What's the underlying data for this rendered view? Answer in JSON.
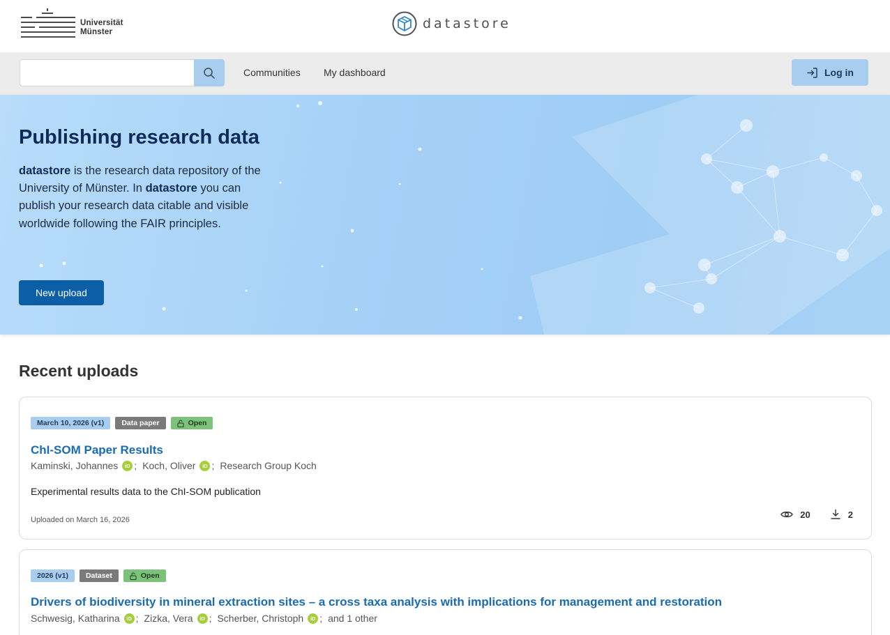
{
  "header": {
    "university_line1": "Universität",
    "university_line2": "Münster",
    "app_name": "datastore"
  },
  "nav": {
    "search_placeholder": "",
    "links": [
      "Communities",
      "My dashboard"
    ],
    "login_label": "Log in"
  },
  "hero": {
    "title": "Publishing research data",
    "text_1_bold": "datastore",
    "text_2": " is the research data repository of the University of Münster. In ",
    "text_3_bold": "datastore",
    "text_4": " you can publish your research data citable and visible worldwide following the FAIR principles.",
    "upload_label": "New upload"
  },
  "recent": {
    "title": "Recent uploads",
    "records": [
      {
        "date_badge": "March 10, 2026 (v1)",
        "type_badge": "Data paper",
        "access_badge": "Open",
        "title": "ChI-SOM Paper Results",
        "creators": [
          {
            "name": "Kaminski, Johannes",
            "orcid": true
          },
          {
            "name": "Koch, Oliver",
            "orcid": true
          },
          {
            "name": "Research Group Koch",
            "orcid": false
          }
        ],
        "description": "Experimental results data to the ChI-SOM publication",
        "uploaded": "Uploaded on March 16, 2026",
        "views": "20",
        "downloads": "2"
      },
      {
        "date_badge": "2026 (v1)",
        "type_badge": "Dataset",
        "access_badge": "Open",
        "title": "Drivers of biodiversity in mineral extraction sites – a cross taxa analysis with implications for management and restoration",
        "creators": [
          {
            "name": "Schwesig, Katharina",
            "orcid": true
          },
          {
            "name": "Zizka, Vera",
            "orcid": true
          },
          {
            "name": "Scherber, Christoph",
            "orcid": true
          },
          {
            "name": "and 1 other",
            "orcid": false
          }
        ]
      }
    ]
  },
  "orcid_label": "iD",
  "colors": {
    "primary": "#0c5fa6",
    "link": "#1a6bb2",
    "accent_light": "#a8cdee",
    "open_badge": "#7dc27a",
    "orcid": "#a6ce39"
  },
  "icons": [
    "search-icon",
    "login-icon",
    "datastore-cube-icon",
    "lock-open-icon",
    "eye-icon",
    "download-icon",
    "orcid-icon"
  ]
}
